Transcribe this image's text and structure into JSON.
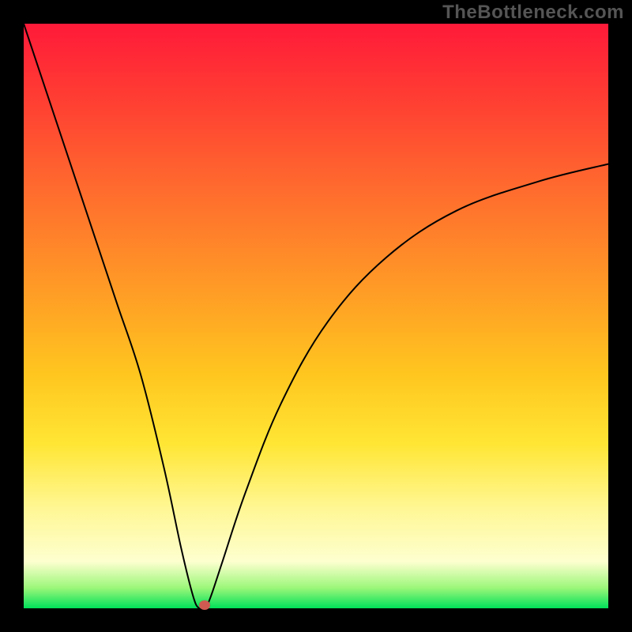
{
  "watermark": "TheBottleneck.com",
  "chart_data": {
    "type": "line",
    "title": "",
    "xlabel": "",
    "ylabel": "",
    "xlim": [
      0,
      100
    ],
    "ylim": [
      0,
      100
    ],
    "grid": false,
    "legend": false,
    "background_gradient": {
      "type": "vertical",
      "direction": "top-to-bottom",
      "stops": [
        {
          "pos": 0.0,
          "color": "#ff1a39"
        },
        {
          "pos": 0.12,
          "color": "#ff3b33"
        },
        {
          "pos": 0.28,
          "color": "#ff6a2e"
        },
        {
          "pos": 0.45,
          "color": "#ff9a26"
        },
        {
          "pos": 0.6,
          "color": "#ffc61f"
        },
        {
          "pos": 0.72,
          "color": "#ffe635"
        },
        {
          "pos": 0.83,
          "color": "#fff795"
        },
        {
          "pos": 0.92,
          "color": "#fdffcf"
        },
        {
          "pos": 0.965,
          "color": "#9cf77a"
        },
        {
          "pos": 1.0,
          "color": "#00e05a"
        }
      ]
    },
    "series": [
      {
        "name": "bottleneck-curve",
        "color": "#000000",
        "stroke_width": 2,
        "x": [
          0,
          4,
          8,
          12,
          16,
          20,
          24,
          27,
          29,
          30,
          31,
          32,
          34,
          38,
          44,
          52,
          62,
          74,
          88,
          100
        ],
        "y": [
          100,
          88,
          76,
          64,
          52,
          40,
          24,
          10,
          2,
          0,
          0,
          2,
          8,
          20,
          35,
          49,
          60,
          68,
          73,
          76
        ]
      }
    ],
    "marker": {
      "name": "optimal-point",
      "x": 31,
      "y": 0.5,
      "color": "#cf5a52"
    }
  }
}
